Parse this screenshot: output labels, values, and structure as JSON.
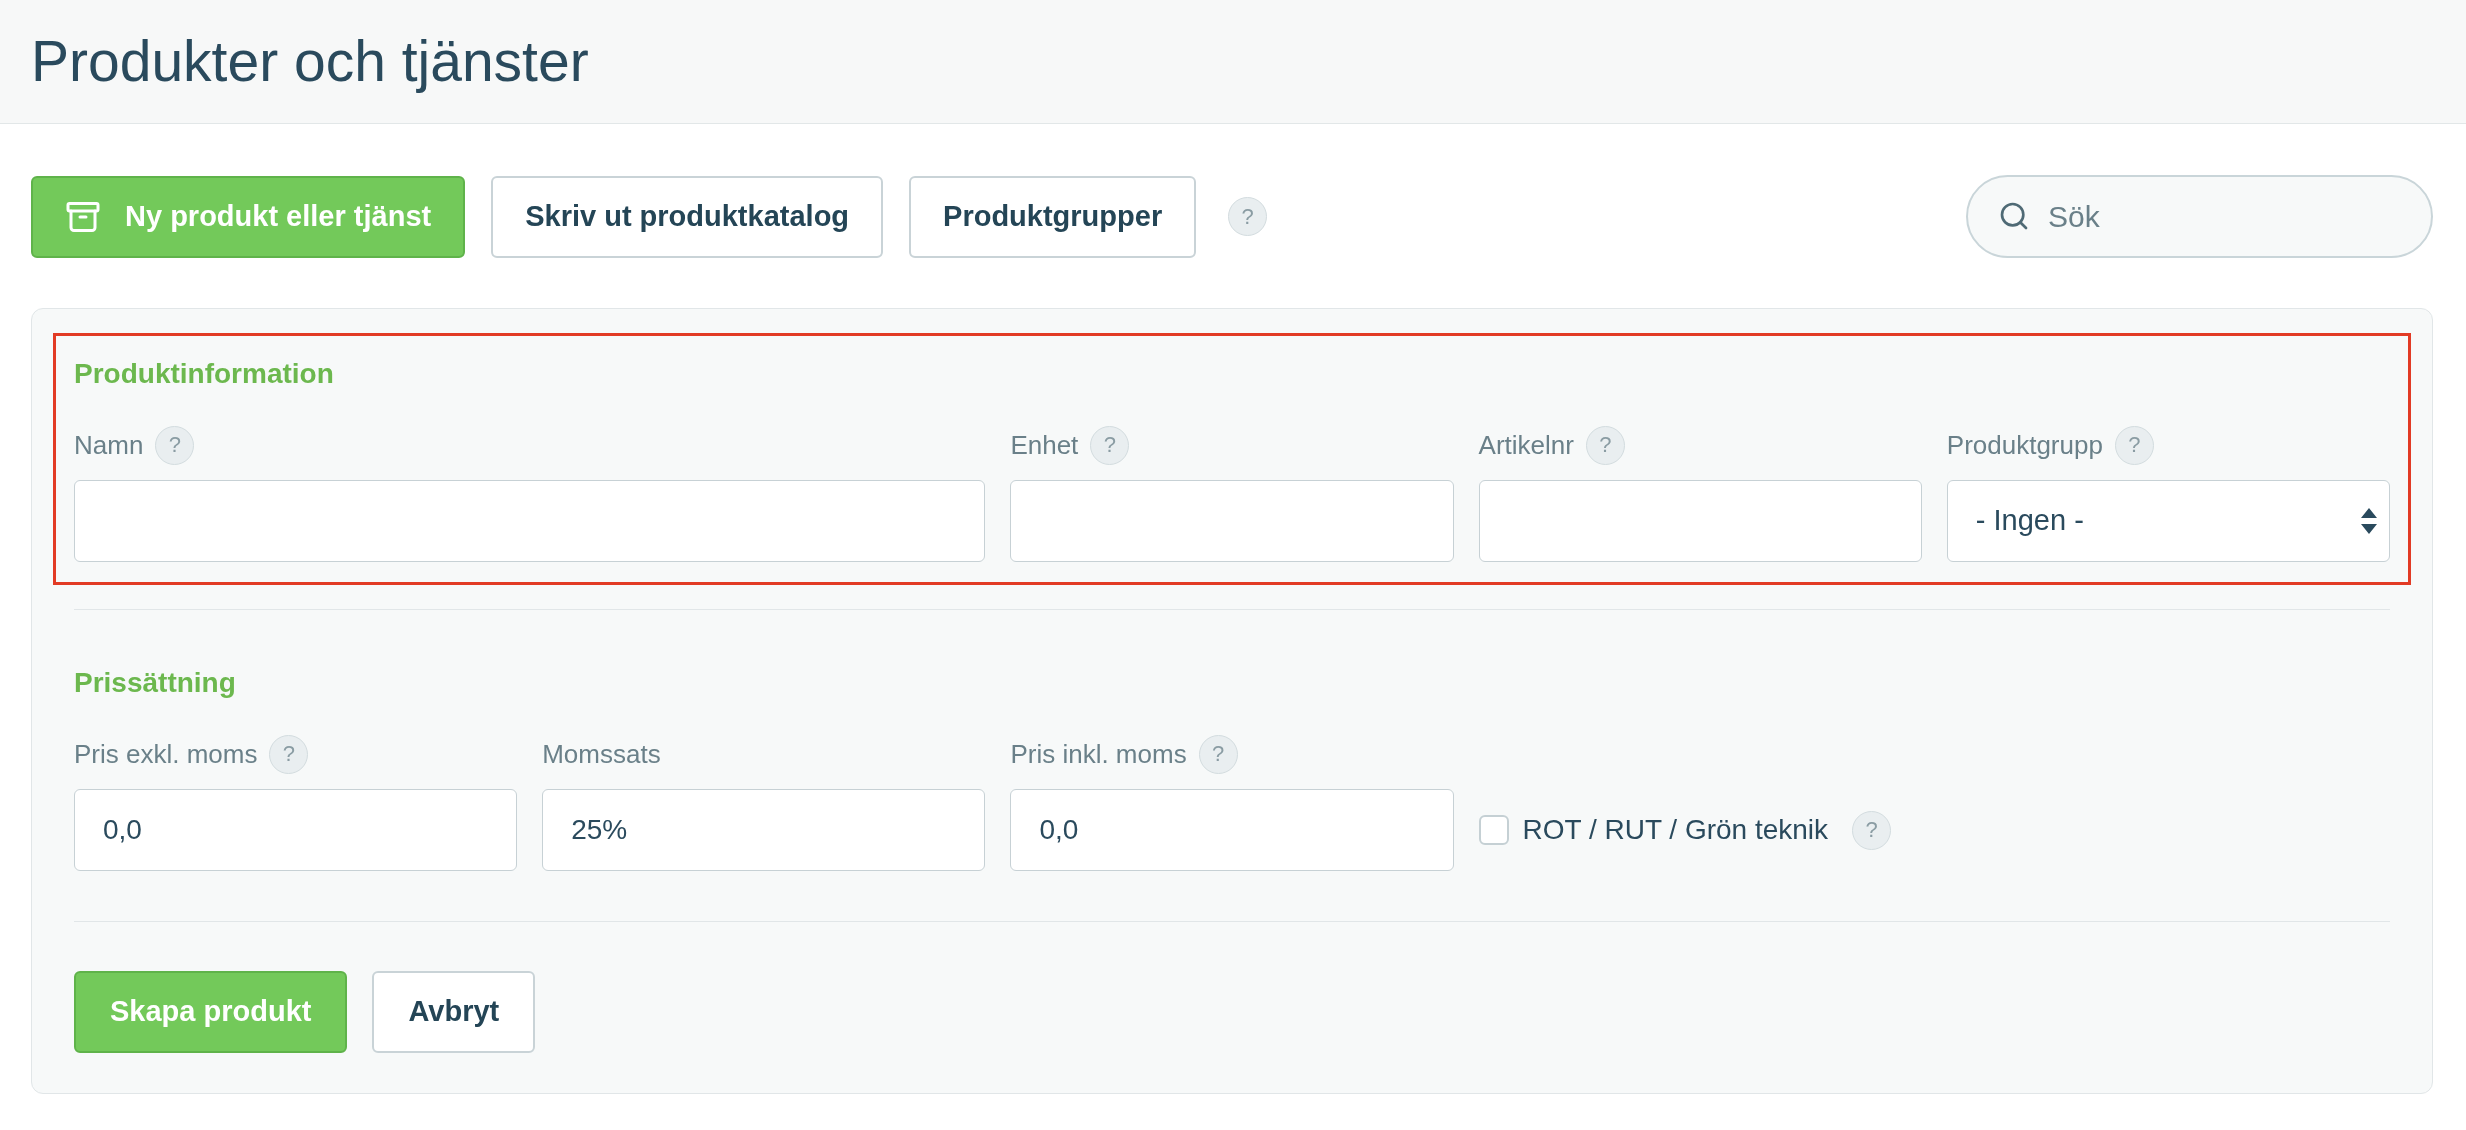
{
  "page": {
    "title": "Produkter och tjänster"
  },
  "toolbar": {
    "buttons": [
      {
        "label": "Ny produkt eller tjänst",
        "kind": "new"
      },
      {
        "label": "Skriv ut produktkatalog",
        "kind": "plain"
      },
      {
        "label": "Produktgrupper",
        "kind": "plain"
      }
    ],
    "help": "?",
    "search": {
      "placeholder": "Sök"
    }
  },
  "form": {
    "sections": [
      {
        "title": "Produktinformation",
        "highlighted": true,
        "fields": [
          {
            "kind": "text",
            "label": "Namn",
            "help": "?"
          },
          {
            "kind": "text",
            "label": "Enhet",
            "help": "?"
          },
          {
            "kind": "text",
            "label": "Artikelnr",
            "help": "?"
          },
          {
            "kind": "select",
            "label": "Produktgrupp",
            "help": "?",
            "value": "- Ingen -"
          }
        ]
      },
      {
        "title": "Prissättning",
        "highlighted": false,
        "fields": [
          {
            "kind": "text",
            "label": "Pris exkl. moms",
            "help": "?",
            "value": "0,0"
          },
          {
            "kind": "text",
            "label": "Momssats",
            "value": "25%"
          },
          {
            "kind": "text",
            "label": "Pris inkl. moms",
            "help": "?",
            "value": "0,0"
          },
          {
            "kind": "checkbox",
            "label": "ROT / RUT / Grön teknik",
            "help": "?",
            "checked": false
          }
        ]
      }
    ],
    "actions": [
      {
        "label": "Skapa produkt",
        "kind": "submit"
      },
      {
        "label": "Avbryt",
        "kind": "plain"
      }
    ]
  }
}
